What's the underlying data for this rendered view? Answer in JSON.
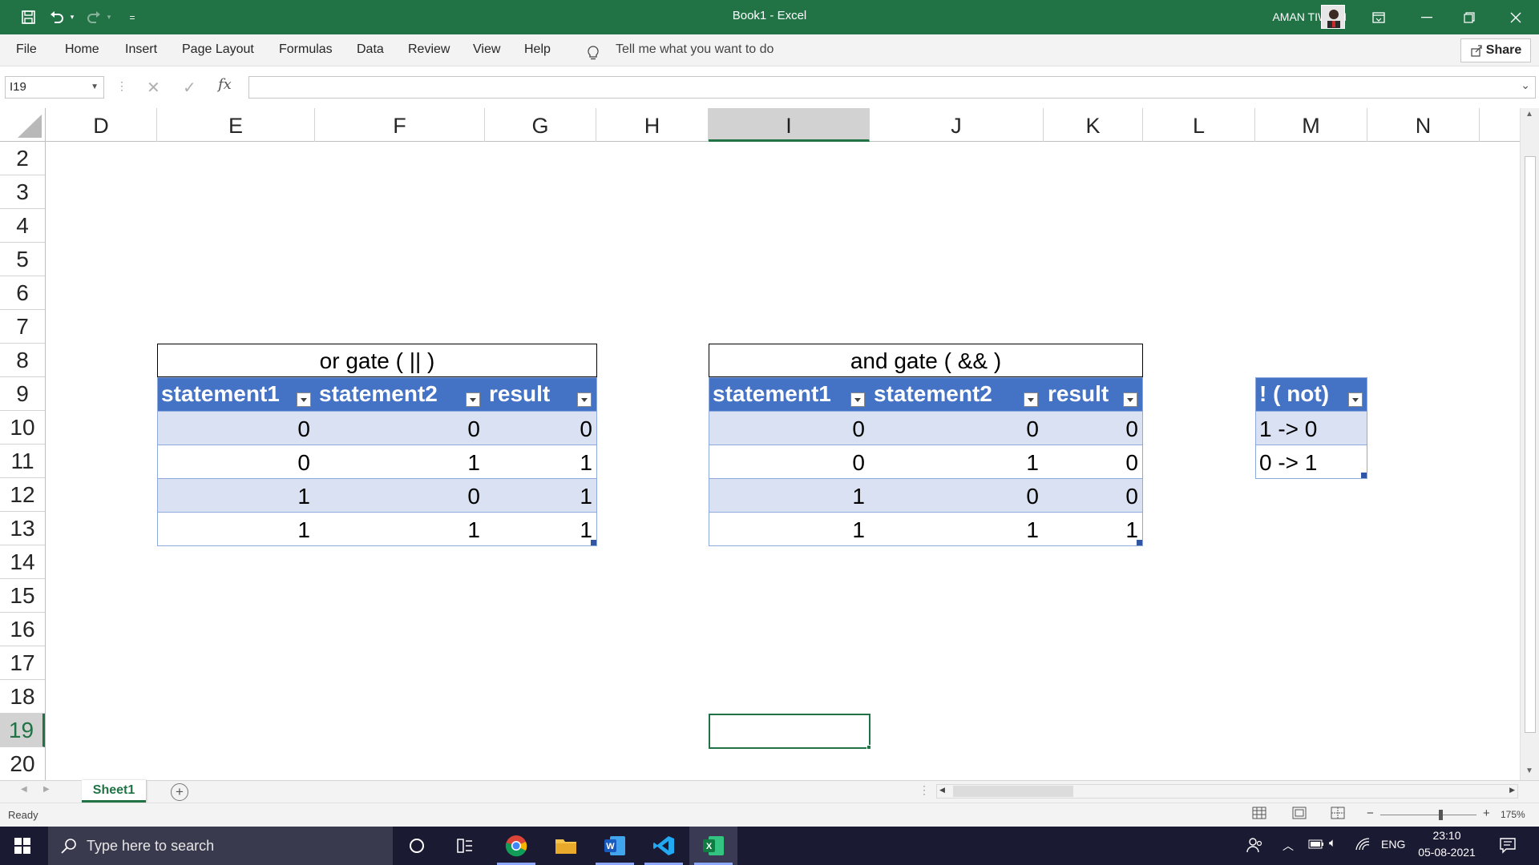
{
  "window": {
    "title": "Book1  -  Excel",
    "user": "AMAN TIWARI",
    "qat_more": "="
  },
  "menu": {
    "items": [
      "File",
      "Home",
      "Insert",
      "Page Layout",
      "Formulas",
      "Data",
      "Review",
      "View",
      "Help"
    ],
    "tell_me": "Tell me what you want to do",
    "share": "Share"
  },
  "formula_bar": {
    "name_box": "I19",
    "fx": "fx",
    "value": ""
  },
  "columns": [
    "D",
    "E",
    "F",
    "G",
    "H",
    "I",
    "J",
    "K",
    "L",
    "M",
    "N"
  ],
  "selected_column": "I",
  "rows": [
    "2",
    "3",
    "4",
    "5",
    "6",
    "7",
    "8",
    "9",
    "10",
    "11",
    "12",
    "13",
    "14",
    "15",
    "16",
    "17",
    "18",
    "19",
    "20"
  ],
  "selected_row": "19",
  "or_table": {
    "title": "or gate ( || )",
    "headers": [
      "statement1",
      "statement2",
      "result"
    ],
    "rows": [
      [
        "0",
        "0",
        "0"
      ],
      [
        "0",
        "1",
        "1"
      ],
      [
        "1",
        "0",
        "1"
      ],
      [
        "1",
        "1",
        "1"
      ]
    ]
  },
  "and_table": {
    "title": "and gate ( && )",
    "headers": [
      "statement1",
      "statement2",
      "result"
    ],
    "rows": [
      [
        "0",
        "0",
        "0"
      ],
      [
        "0",
        "1",
        "0"
      ],
      [
        "1",
        "0",
        "0"
      ],
      [
        "1",
        "1",
        "1"
      ]
    ]
  },
  "not_table": {
    "header": "! ( not)",
    "rows": [
      "1 -> 0",
      "0 -> 1"
    ]
  },
  "sheets": {
    "active": "Sheet1"
  },
  "status": {
    "text": "Ready",
    "zoom": "175%"
  },
  "taskbar": {
    "search_placeholder": "Type here to search",
    "language": "ENG",
    "time": "23:10",
    "date": "05-08-2021"
  },
  "colors": {
    "excel_green": "#217346",
    "table_header": "#4472c4",
    "table_band": "#d9e1f2"
  }
}
